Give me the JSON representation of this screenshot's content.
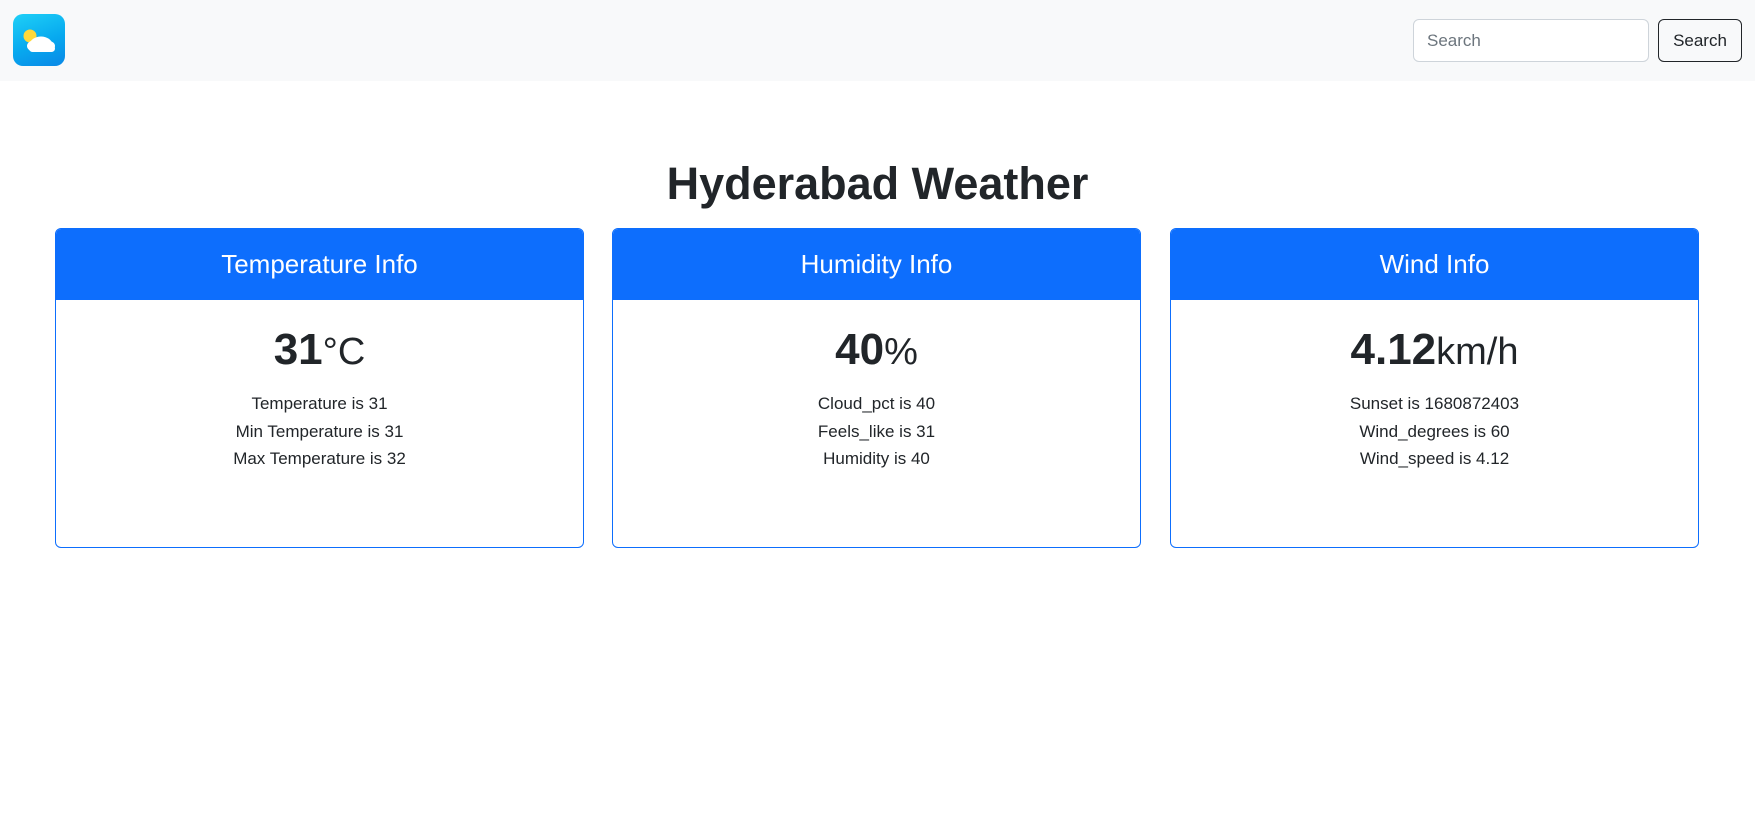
{
  "navbar": {
    "logo_icon": "weather-partly-cloudy-icon",
    "search_placeholder": "Search",
    "search_value": "",
    "search_button_label": "Search"
  },
  "page_title": "Hyderabad Weather",
  "colors": {
    "primary": "#0d6efd",
    "navbar_bg": "#f8f9fa",
    "text": "#212529"
  },
  "cards": [
    {
      "title": "Temperature Info",
      "value": "31",
      "unit": "°C",
      "lines": [
        "Temperature is 31",
        "Min Temperature is 31",
        "Max Temperature is 32"
      ]
    },
    {
      "title": "Humidity Info",
      "value": "40",
      "unit": "%",
      "lines": [
        "Cloud_pct is 40",
        "Feels_like is 31",
        "Humidity is 40"
      ]
    },
    {
      "title": "Wind Info",
      "value": "4.12",
      "unit": "km/h",
      "lines": [
        "Sunset is 1680872403",
        "Wind_degrees is 60",
        "Wind_speed is 4.12"
      ]
    }
  ]
}
